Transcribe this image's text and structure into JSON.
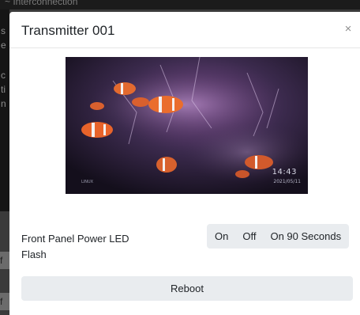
{
  "background": {
    "heading_fragment": "~ Interconnection",
    "side_chars": [
      "s",
      "e",
      "c",
      "ti",
      "n"
    ],
    "chip_chars": [
      "f",
      "f"
    ]
  },
  "modal": {
    "title": "Transmitter 001",
    "close_glyph": "×"
  },
  "video_preview": {
    "time": "14:43",
    "date": "2021/05/11",
    "logo_text": "LINUX"
  },
  "led_setting": {
    "label": "Front Panel Power LED Flash",
    "options": [
      "On",
      "Off",
      "On 90 Seconds"
    ]
  },
  "actions": {
    "reboot_label": "Reboot"
  },
  "colors": {
    "button_bg": "#e9ecef",
    "text": "#212529",
    "overlay": "#3a3a3a"
  }
}
